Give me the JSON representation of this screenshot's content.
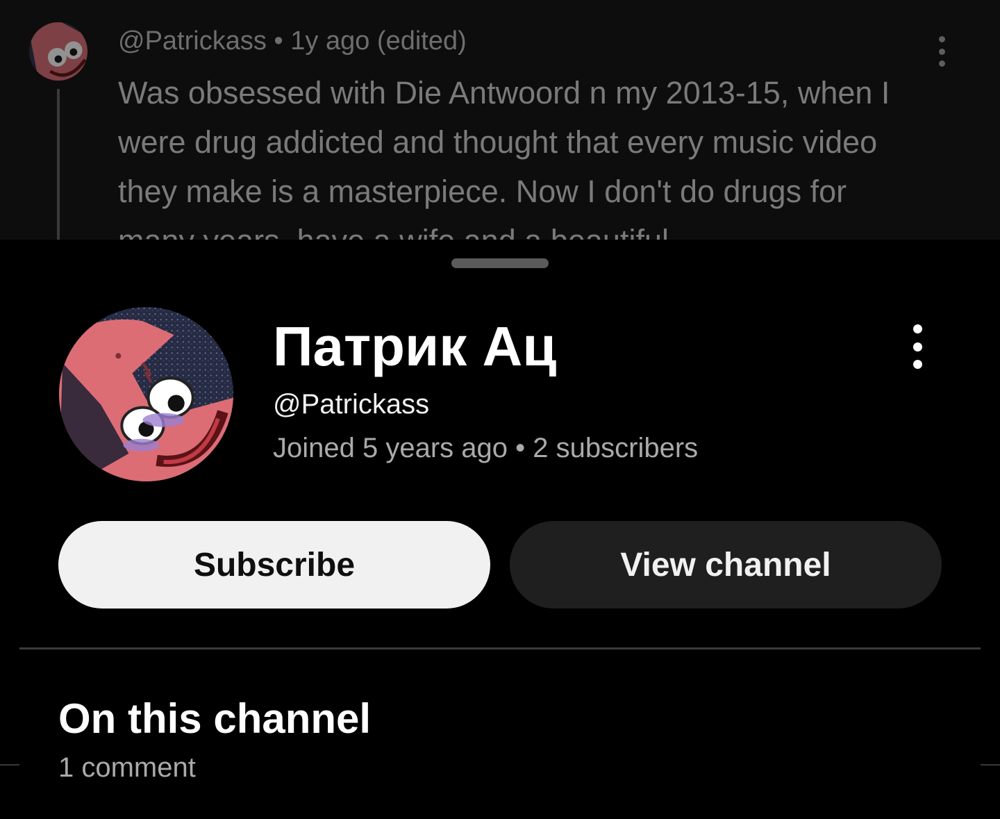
{
  "background_comment": {
    "author_handle": "@Patrickass",
    "time": "1y ago (edited)",
    "meta_separator": "•",
    "text": "Was obsessed with Die Antwoord n my 2013-15, when I were drug addicted and thought that every music video they make is a masterpiece. Now I don't do drugs for many years, have a wife and a beautiful"
  },
  "channel": {
    "name": "Патрик Ац",
    "handle": "@Patrickass",
    "joined": "Joined 5 years ago",
    "separator": "•",
    "subscribers": "2 subscribers",
    "avatar_icon": "patrick-star-avatar-icon"
  },
  "actions": {
    "subscribe_label": "Subscribe",
    "view_channel_label": "View channel"
  },
  "on_this_channel": {
    "title": "On this channel",
    "count": "1 comment"
  },
  "colors": {
    "background": "#000000",
    "subscribe_bg": "#f1f1f1",
    "view_channel_bg": "#1f1f1f",
    "secondary_text": "#aaaaaa",
    "avatar_pink": "#e8787f"
  }
}
